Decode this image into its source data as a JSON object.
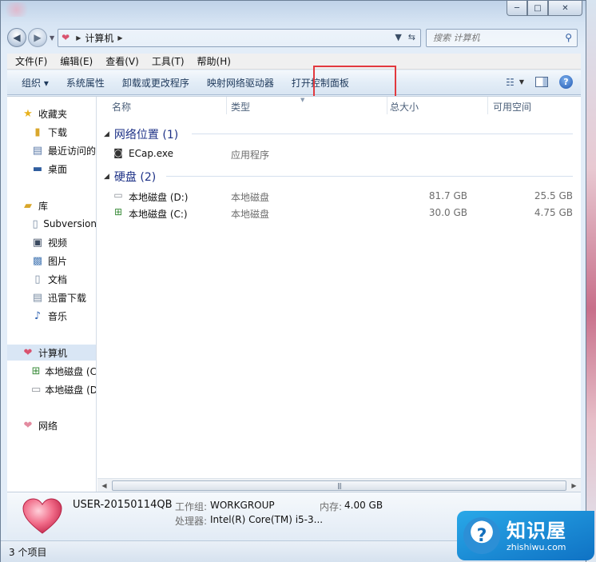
{
  "window": {
    "min_label": "─",
    "max_label": "□",
    "close_label": "✕"
  },
  "address": {
    "location": "计算机",
    "search_placeholder": "搜索 计算机"
  },
  "menu": [
    "文件(F)",
    "编辑(E)",
    "查看(V)",
    "工具(T)",
    "帮助(H)"
  ],
  "toolbar": {
    "organize": "组织 ▾",
    "system_properties": "系统属性",
    "uninstall": "卸载或更改程序",
    "map_drive": "映射网络驱动器",
    "control_panel": "打开控制面板",
    "help": "?"
  },
  "nav": {
    "favorites": "收藏夹",
    "downloads": "下载",
    "recent": "最近访问的",
    "desktop": "桌面",
    "libraries": "库",
    "subversion": "Subversion",
    "videos": "视频",
    "pictures": "图片",
    "documents": "文档",
    "xunlei": "迅雷下载",
    "music": "音乐",
    "computer": "计算机",
    "local_c": "本地磁盘 (C",
    "local_d": "本地磁盘 (D",
    "network": "网络"
  },
  "columns": {
    "name": "名称",
    "type": "类型",
    "total": "总大小",
    "free": "可用空间"
  },
  "groups": {
    "network_location": "网络位置 (1)",
    "hard_disks": "硬盘 (2)"
  },
  "files": [
    {
      "name": "ECap.exe",
      "type": "应用程序",
      "total": "",
      "free": ""
    }
  ],
  "drives": [
    {
      "name": "本地磁盘 (D:)",
      "type": "本地磁盘",
      "total": "81.7 GB",
      "free": "25.5 GB"
    },
    {
      "name": "本地磁盘 (C:)",
      "type": "本地磁盘",
      "total": "30.0 GB",
      "free": "4.75 GB"
    }
  ],
  "details": {
    "computer_name": "USER-20150114QB",
    "workgroup_label": "工作组:",
    "workgroup_value": "WORKGROUP",
    "memory_label": "内存:",
    "memory_value": "4.00 GB",
    "cpu_label": "处理器:",
    "cpu_value": "Intel(R) Core(TM) i5-3..."
  },
  "status": {
    "item_count": "3 个项目"
  },
  "watermark": {
    "logo": "?",
    "title": "知识屋",
    "subtitle": "zhishiwu.com"
  },
  "colors": {
    "highlight_border": "#e2393e",
    "group_header": "#1e3287",
    "watermark_blue": "#1a8ad8"
  }
}
